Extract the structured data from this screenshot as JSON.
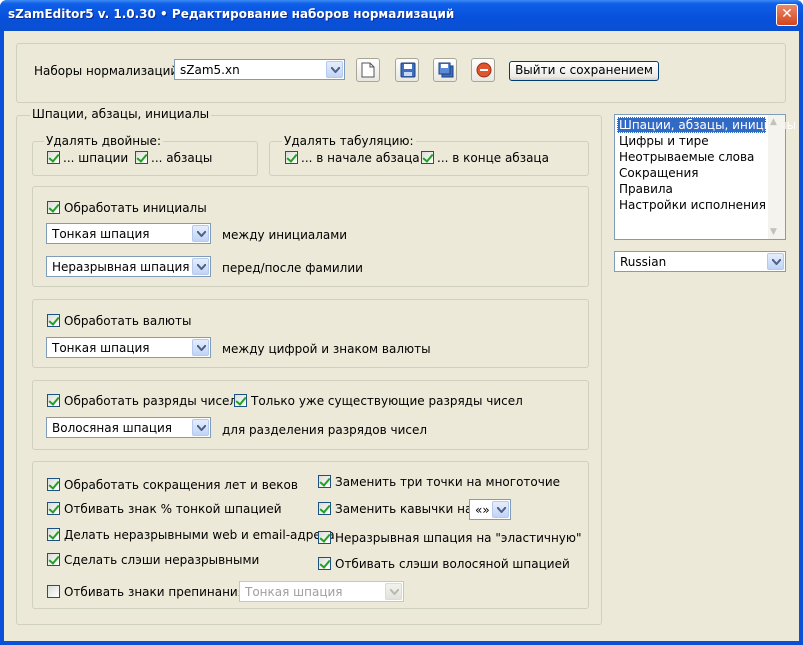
{
  "window": {
    "title": "sZamEditor5 v. 1.0.30 • Редактирование наборов нормализаций",
    "close_label": "✕"
  },
  "toolbar": {
    "sets_label": "Наборы нормализаций",
    "set_value": "sZam5.xn",
    "save_exit_label": "Выйти с сохранением"
  },
  "main_group": {
    "title": "Шпации, абзацы, инициалы"
  },
  "doubles": {
    "title": "Удалять двойные:",
    "spaces": "... шпации",
    "paragraphs": "... абзацы"
  },
  "tabs": {
    "title": "Удалять табуляцию:",
    "start": "... в начале абзаца",
    "end": "... в конце абзаца"
  },
  "initials": {
    "check": "Обработать инициалы",
    "combo1": "Тонкая шпация",
    "label1": "между инициалами",
    "combo2": "Неразрывная шпация",
    "label2": "перед/после фамилии"
  },
  "currency": {
    "check": "Обработать валюты",
    "combo": "Тонкая шпация",
    "label": "между цифрой и знаком валюты"
  },
  "digits": {
    "check": "Обработать разряды чисел",
    "check2": "Только уже существующие разряды чисел",
    "combo": "Волосяная шпация",
    "label": "для разделения разрядов чисел"
  },
  "misc": {
    "years": "Обработать сокращения лет и веков",
    "percent": "Отбивать знак % тонкой шпацией",
    "web": "Делать неразрывными web и email-адреса",
    "slashes": "Сделать слэши неразрывными",
    "punct": "Отбивать знаки препинания",
    "punct_combo": "Тонкая шпация",
    "dots": "Заменить три точки на многоточие",
    "quotes": "Заменить кавычки на",
    "quotes_combo": "«»",
    "elastic": "Неразрывная шпация на \"эластичную\"",
    "slash_hair": "Отбивать слэши волосяной шпацией"
  },
  "sidebar": {
    "items": [
      "Шпации, абзацы, инициалы",
      "Цифры и тире",
      "Неотрываемые слова",
      "Сокращения",
      "Правила",
      "Настройки исполнения"
    ],
    "language": "Russian"
  },
  "colors": {
    "titlebar": "#0a50d8",
    "selection": "#316ac5",
    "check": "#21a121",
    "dialog_bg": "#ece9d8"
  }
}
